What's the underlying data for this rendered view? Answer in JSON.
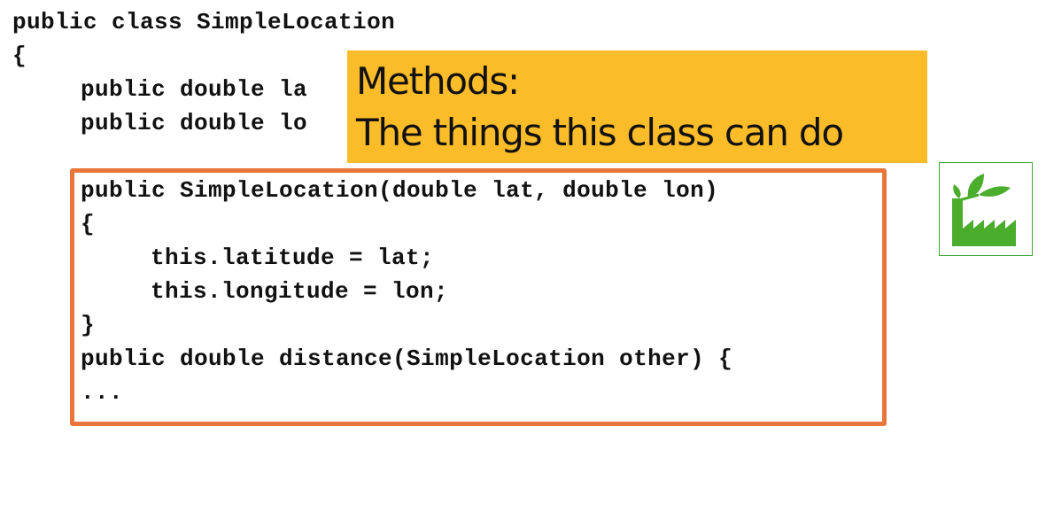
{
  "code": {
    "lines": [
      "public class SimpleLocation",
      "{",
      "public double la",
      "public double lo",
      "public SimpleLocation(double lat, double lon)",
      "{",
      "this.latitude = lat;",
      "this.longitude = lon;",
      "}",
      "public double distance(SimpleLocation other) {",
      "..."
    ]
  },
  "callout": {
    "line1": "Methods:",
    "line2": "The things this class can do"
  },
  "icon": {
    "name": "factory-leaf-icon",
    "color": "#4aad2c"
  },
  "colors": {
    "callout_bg": "#fbbc2a",
    "box_border": "#e8763a",
    "icon_green": "#4aad2c"
  }
}
